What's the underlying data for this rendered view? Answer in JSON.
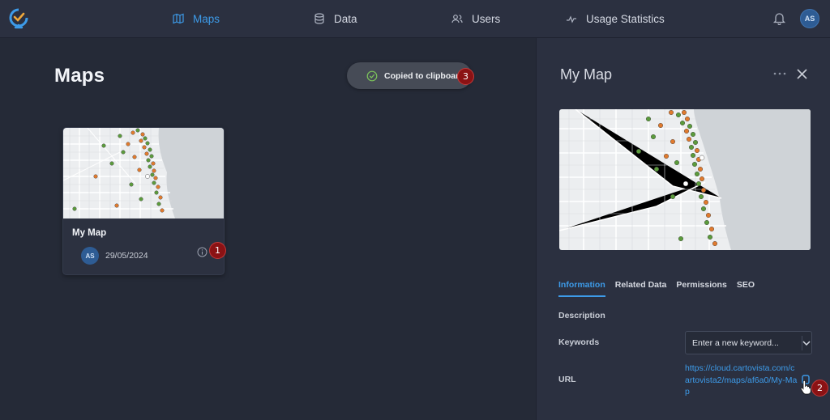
{
  "nav": {
    "items": [
      {
        "label": "Maps",
        "icon": "map-icon",
        "active": true
      },
      {
        "label": "Data",
        "icon": "database-icon",
        "active": false
      },
      {
        "label": "Users",
        "icon": "users-icon",
        "active": false
      },
      {
        "label": "Usage Statistics",
        "icon": "activity-icon",
        "active": false
      }
    ],
    "avatar_initials": "AS"
  },
  "page": {
    "title": "Maps"
  },
  "toast": {
    "message": "Copied to clipboard"
  },
  "card": {
    "title": "My Map",
    "avatar_initials": "AS",
    "date": "29/05/2024"
  },
  "panel": {
    "title": "My Map",
    "tabs": [
      "Information",
      "Related Data",
      "Permissions",
      "SEO"
    ],
    "active_tab": "Information",
    "description_label": "Description",
    "keywords_label": "Keywords",
    "keywords_placeholder": "Enter a new keyword...",
    "url_label": "URL",
    "url_value": "https://cloud.cartovista.com/cartovista2/maps/af6a0/My-Map"
  },
  "annotations": [
    "1",
    "2",
    "3"
  ],
  "colors": {
    "accent": "#3d9be9",
    "background": "#252a37",
    "panel": "#2b3040",
    "badge": "#8b1214",
    "marker_green": "#5b9b3c",
    "marker_orange": "#e07a2e"
  }
}
